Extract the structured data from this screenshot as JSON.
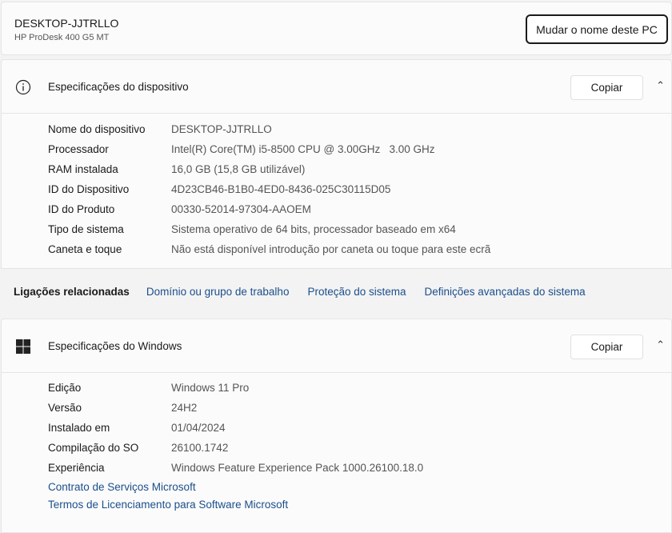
{
  "header": {
    "pc_name": "DESKTOP-JJTRLLO",
    "model": "HP ProDesk 400 G5 MT",
    "rename_label": "Mudar o nome deste PC"
  },
  "device_specs": {
    "title": "Especificações do dispositivo",
    "copy_label": "Copiar",
    "rows": [
      {
        "label": "Nome do dispositivo",
        "value": "DESKTOP-JJTRLLO"
      },
      {
        "label": "Processador",
        "value": "Intel(R) Core(TM) i5-8500 CPU @ 3.00GHz   3.00 GHz"
      },
      {
        "label": "RAM instalada",
        "value": "16,0 GB (15,8 GB utilizável)"
      },
      {
        "label": "ID do Dispositivo",
        "value": "4D23CB46-B1B0-4ED0-8436-025C30115D05"
      },
      {
        "label": "ID do Produto",
        "value": "00330-52014-97304-AAOEM"
      },
      {
        "label": "Tipo de sistema",
        "value": "Sistema operativo de 64 bits, processador baseado em x64"
      },
      {
        "label": "Caneta e toque",
        "value": "Não está disponível introdução por caneta ou toque para este ecrã"
      }
    ]
  },
  "related": {
    "label": "Ligações relacionadas",
    "links": [
      "Domínio ou grupo de trabalho",
      "Proteção do sistema",
      "Definições avançadas do sistema"
    ]
  },
  "windows_specs": {
    "title": "Especificações do Windows",
    "copy_label": "Copiar",
    "rows": [
      {
        "label": "Edição",
        "value": "Windows 11 Pro"
      },
      {
        "label": "Versão",
        "value": "24H2"
      },
      {
        "label": "Instalado em",
        "value": "01/04/2024"
      },
      {
        "label": "Compilação do SO",
        "value": "26100.1742"
      },
      {
        "label": "Experiência",
        "value": "Windows Feature Experience Pack 1000.26100.18.0"
      }
    ],
    "links": [
      "Contrato de Serviços Microsoft",
      "Termos de Licenciamento para Software Microsoft"
    ]
  }
}
